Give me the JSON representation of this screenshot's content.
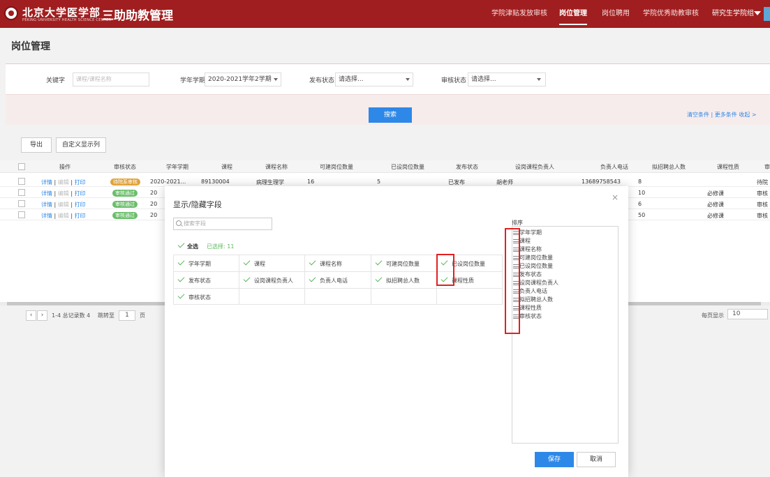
{
  "header": {
    "logo_text": "北京大学医学部",
    "logo_sub": "PEKING UNIVERSITY HEALTH SCIENCE CENTER",
    "app_title": "三助助教管理",
    "nav": [
      "学院津贴发放审核",
      "岗位管理",
      "岗位聘用",
      "学院优秀助教审核"
    ],
    "user": "研究生学院组",
    "brand_color": "#a01e1f"
  },
  "page_title": "岗位管理",
  "filters": {
    "keyword_label": "关键字",
    "keyword_placeholder": "课程/课程名称",
    "term_label": "学年学期",
    "term_value": "2020-2021学年2学期",
    "publish_label": "发布状态",
    "publish_value": "请选择...",
    "review_label": "审核状态",
    "review_value": "请选择...",
    "search_label": "搜索",
    "links": "清空条件 | 更多条件  收起 >"
  },
  "toolbar": {
    "export": "导出",
    "custom_columns": "自定义显示列"
  },
  "table": {
    "headers": [
      "操作",
      "审核状态",
      "学年学期",
      "课程",
      "课程名称",
      "可建岗位数量",
      "已设岗位数量",
      "发布状态",
      "设岗课程负责人",
      "负责人电话",
      "拟招聘总人数",
      "课程性质",
      "审"
    ],
    "ops": {
      "detail": "详情",
      "edit": "编辑",
      "print": "打印"
    },
    "rows": [
      {
        "status": "待院系审核",
        "status_color": "#e0a23a",
        "term": "2020-2021...",
        "course": "89130004",
        "name": "病理生理学",
        "can": "16",
        "set": "5",
        "pub": "已发布",
        "owner": "胡老师",
        "phone": "13689758543",
        "total": "8",
        "nature": "",
        "review": "待院"
      },
      {
        "status": "审核通过",
        "status_color": "#6bbd6b",
        "term": "20",
        "course": "",
        "name": "",
        "can": "",
        "set": "",
        "pub": "",
        "owner": "",
        "phone": "",
        "total": "10",
        "nature": "必修课",
        "review": "审核"
      },
      {
        "status": "审核通过",
        "status_color": "#6bbd6b",
        "term": "20",
        "course": "",
        "name": "",
        "can": "",
        "set": "",
        "pub": "",
        "owner": "",
        "phone": "",
        "total": "6",
        "nature": "必修课",
        "review": "审核"
      },
      {
        "status": "审核通过",
        "status_color": "#6bbd6b",
        "term": "20",
        "course": "",
        "name": "",
        "can": "",
        "set": "",
        "pub": "",
        "owner": "",
        "phone": "",
        "total": "50",
        "nature": "必修课",
        "review": "审核"
      }
    ]
  },
  "pager": {
    "summary": "1-4 总记录数 4",
    "jump_label": "跳转至",
    "page": "1",
    "page_unit": "页",
    "per_page_label": "每页显示",
    "per_page": "10"
  },
  "modal": {
    "title": "显示/隐藏字段",
    "close": "×",
    "search_placeholder": "搜索字段",
    "select_all": "全选",
    "selected": "已选择: 11",
    "fields": [
      "学年学期",
      "课程",
      "课程名称",
      "可建岗位数量",
      "已设岗位数量",
      "发布状态",
      "设岗课程负责人",
      "负责人电话",
      "拟招聘总人数",
      "课程性质",
      "审核状态"
    ],
    "sort_label": "排序",
    "sort_items": [
      "学年学期",
      "课程",
      "课程名称",
      "可建岗位数量",
      "已设岗位数量",
      "发布状态",
      "设岗课程负责人",
      "负责人电话",
      "拟招聘总人数",
      "课程性质",
      "审核状态"
    ],
    "save": "保存",
    "cancel": "取消"
  }
}
